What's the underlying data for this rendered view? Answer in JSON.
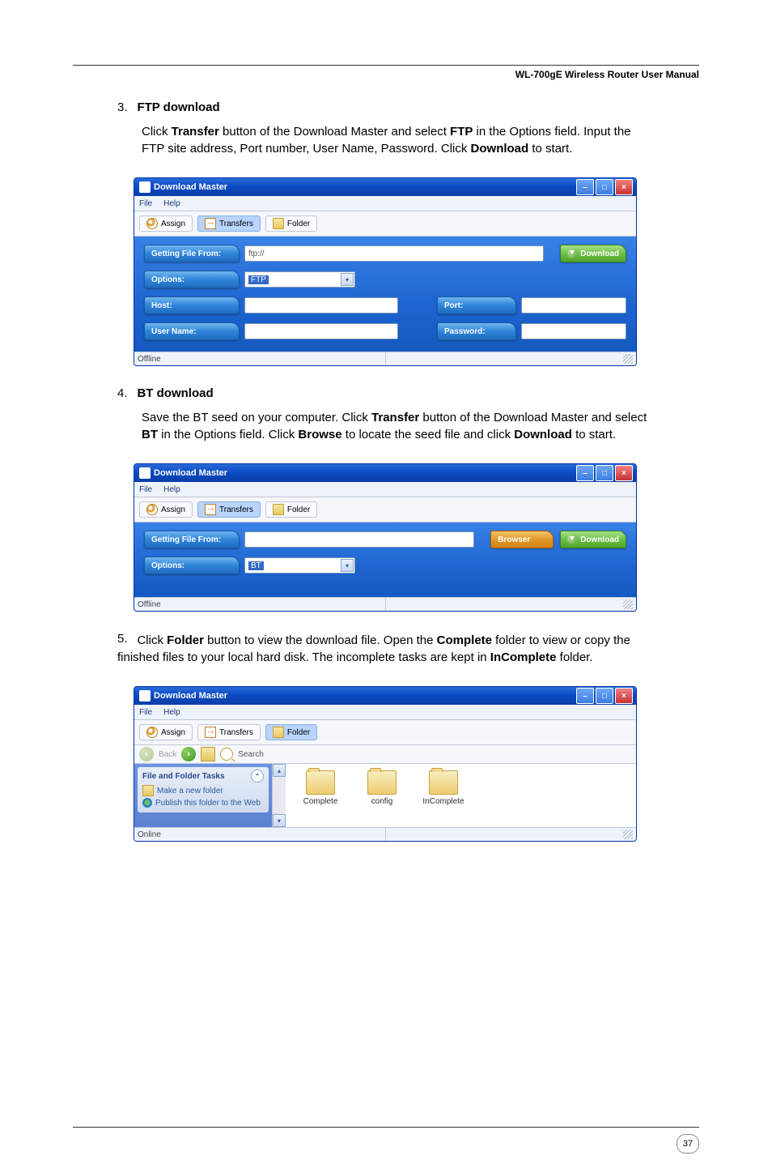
{
  "header": {
    "title": "WL-700gE Wireless Router User Manual"
  },
  "steps": {
    "s3": {
      "num": "3.",
      "heading": "FTP download",
      "text_before": "Click ",
      "w1": "Transfer",
      "text_mid1": " button of the Download Master and select ",
      "w2": "FTP",
      "text_mid2": " in the Options field. Input the FTP site address, Port number, User Name, Password. Click ",
      "w3": "Download",
      "text_after": " to start."
    },
    "s4": {
      "num": "4.",
      "heading": "BT download",
      "text_before": "Save the BT seed on your computer. Click ",
      "w1": "Transfer",
      "text_mid1": " button of the Download Master and select ",
      "w2": "BT",
      "text_mid2": " in the Options field. Click ",
      "w3": "Browse",
      "text_mid3": " to locate the seed file and click ",
      "w4": "Download",
      "text_after": " to start."
    },
    "s5": {
      "num": "5.",
      "text_before": "Click ",
      "w1": "Folder",
      "text_mid1": " button to view the download file. Open the ",
      "w2": "Complete",
      "text_mid2": " folder to view or copy the finished files to your local hard disk. The incomplete tasks are kept in ",
      "w3": "InComplete",
      "text_after": " folder."
    }
  },
  "win": {
    "title": "Download Master",
    "menu_file": "File",
    "menu_help": "Help",
    "tab_assign": "Assign",
    "tab_transfers": "Transfers",
    "tab_folder": "Folder",
    "label_getting_file_from": "Getting File From:",
    "label_options": "Options:",
    "label_host": "Host:",
    "label_port": "Port:",
    "label_username": "User Name:",
    "label_password": "Password:",
    "field_ftp_value": "ftp://",
    "select_ftp": "FTP",
    "select_bt": "BT",
    "btn_download": "Download",
    "btn_browser": "Browser",
    "status_offline": "Offline",
    "status_online": "Online",
    "nav_back": "Back",
    "nav_search": "Search"
  },
  "explorer": {
    "task_header": "File and Folder Tasks",
    "task_new_folder": "Make a new folder",
    "task_publish": "Publish this folder to the Web",
    "folders": [
      "Complete",
      "config",
      "InComplete"
    ]
  },
  "page_number": "37"
}
